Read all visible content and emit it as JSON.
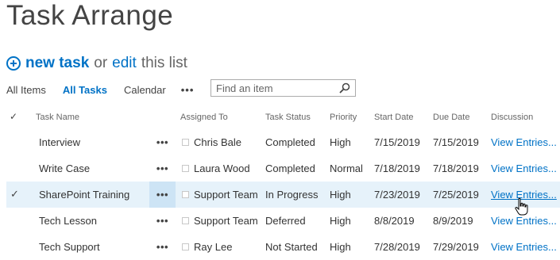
{
  "page": {
    "title": "Task Arrange"
  },
  "actions": {
    "new_task": "new task",
    "or": "or",
    "edit": "edit",
    "this_list": "this list"
  },
  "views": {
    "items": [
      "All Items",
      "All Tasks",
      "Calendar"
    ],
    "active": "All Tasks",
    "more": "•••"
  },
  "search": {
    "placeholder": "Find an item"
  },
  "columns": {
    "check": "✓",
    "task_name": "Task Name",
    "assigned_to": "Assigned To",
    "task_status": "Task Status",
    "priority": "Priority",
    "start_date": "Start Date",
    "due_date": "Due Date",
    "discussion": "Discussion"
  },
  "rows": [
    {
      "task": "Interview",
      "assigned": "Chris Bale",
      "status": "Completed",
      "priority": "High",
      "start": "7/15/2019",
      "due": "7/15/2019",
      "discussion": "View Entries...",
      "more": "•••",
      "check": ""
    },
    {
      "task": "Write Case",
      "assigned": "Laura Wood",
      "status": "Completed",
      "priority": "Normal",
      "start": "7/18/2019",
      "due": "7/18/2019",
      "discussion": "View Entries...",
      "more": "•••",
      "check": ""
    },
    {
      "task": "SharePoint Training",
      "assigned": "Support Team",
      "status": "In Progress",
      "priority": "High",
      "start": "7/23/2019",
      "due": "7/25/2019",
      "discussion": "View Entries...",
      "more": "•••",
      "check": "✓"
    },
    {
      "task": "Tech Lesson",
      "assigned": "Support Team",
      "status": "Deferred",
      "priority": "High",
      "start": "8/8/2019",
      "due": "8/9/2019",
      "discussion": "View Entries...",
      "more": "•••",
      "check": ""
    },
    {
      "task": "Tech Support",
      "assigned": "Ray Lee",
      "status": "Not Started",
      "priority": "High",
      "start": "7/28/2019",
      "due": "7/29/2019",
      "discussion": "View Entries...",
      "more": "•••",
      "check": ""
    }
  ],
  "colors": {
    "accent": "#0072c6",
    "selected_row": "#e6f2fa",
    "selected_menu": "#cde4f5"
  }
}
